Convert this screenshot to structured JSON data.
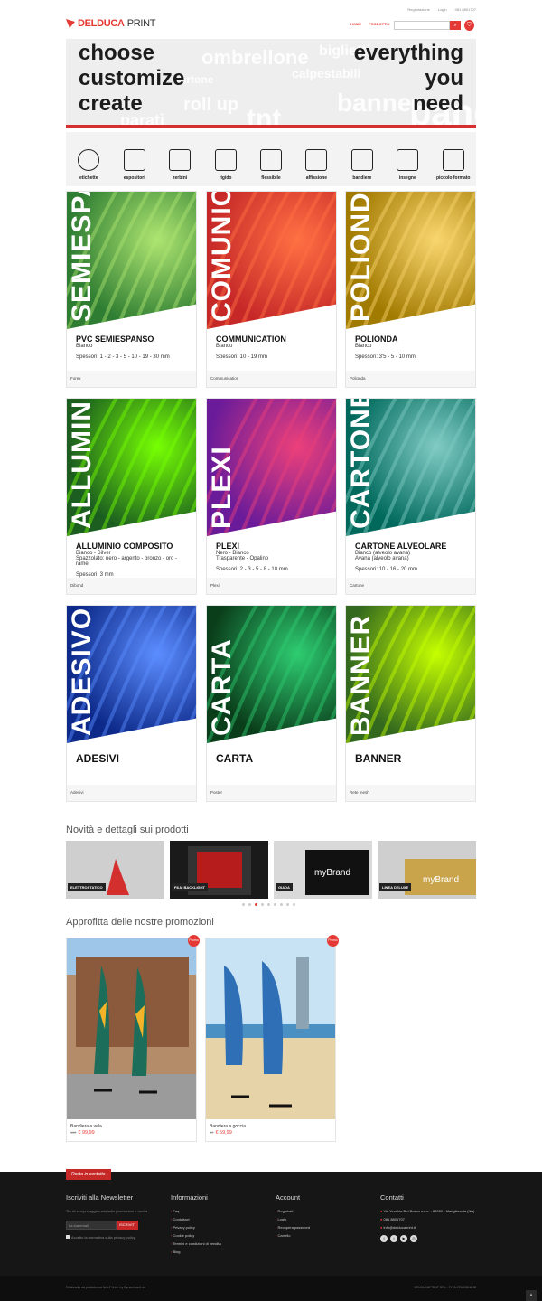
{
  "topbar": {
    "register": "Registrazione",
    "login": "Login",
    "phone": "081 8801707"
  },
  "logo": {
    "part1": "DELDUCA",
    "part2": "PRINT"
  },
  "nav": {
    "home": "HOME",
    "products": "PRODOTTI ▾"
  },
  "search": {
    "placeholder": ""
  },
  "hero": {
    "left": [
      "choose",
      "customize",
      "create"
    ],
    "right": [
      "everything",
      "you",
      "need"
    ],
    "bg_words": [
      "ombrellone",
      "biglietti",
      "cartone",
      "calpestabili",
      "banner",
      "roll up",
      "tnt",
      "bandiere",
      "parati"
    ]
  },
  "categories": [
    "etichette",
    "espositori",
    "zerbini",
    "rigido",
    "flessibile",
    "affissione",
    "bandiere",
    "insegne",
    "piccolo formato"
  ],
  "cards": [
    {
      "vword": "SEMIESPANSO",
      "title": "PVC SEMIESPANSO",
      "sub": [
        "Bianco"
      ],
      "sp": "Spessori: 1 - 2 - 3 - 5 - 10 - 19 - 30 mm",
      "foot": "Forex",
      "c1": "#2e7d32",
      "c2": "#aee571"
    },
    {
      "vword": "COMUNICATION",
      "title": "COMMUNICATION",
      "sub": [
        "Bianco"
      ],
      "sp": "Spessori: 10 - 19 mm",
      "foot": "Communication",
      "c1": "#c62828",
      "c2": "#ff7043"
    },
    {
      "vword": "POLIONDA",
      "title": "POLIONDA",
      "sub": [
        "Bianco"
      ],
      "sp": "Spessori: 3'5 - 5 - 10 mm",
      "foot": "Polionda",
      "c1": "#a17a00",
      "c2": "#f9d56e"
    },
    {
      "vword": "ALLUMINIO",
      "title": "ALLUMINIO COMPOSITO",
      "sub": [
        "Bianco - Silver",
        "Spazzolato: nero - argento - bronzo - oro - rame"
      ],
      "sp": "Spessori: 3 mm",
      "foot": "Dibond",
      "c1": "#1b5e20",
      "c2": "#76ff03"
    },
    {
      "vword": "PLEXI",
      "title": "PLEXI",
      "sub": [
        "Nero - Bianco",
        "Trasparente - Opalino"
      ],
      "sp": "Spessori: 2 - 3 - 5 - 8 - 10 mm",
      "foot": "Plexi",
      "c1": "#6a1b9a",
      "c2": "#ec407a"
    },
    {
      "vword": "CARTONE",
      "title": "CARTONE ALVEOLARE",
      "sub": [
        "Bianco (alveolo avana)",
        "Avana  (alveolo avana)"
      ],
      "sp": "Spessori: 10 - 16 - 20 mm",
      "foot": "Cartone",
      "c1": "#00695c",
      "c2": "#80cbc4"
    },
    {
      "vword": "ADESIVO",
      "title": "ADESIVI",
      "sub": [],
      "sp": "",
      "foot": "Adesivi",
      "c1": "#0d2a8a",
      "c2": "#5c8dff"
    },
    {
      "vword": "CARTA",
      "title": "CARTA",
      "sub": [],
      "sp": "",
      "foot": "Poster",
      "c1": "#0a3d1a",
      "c2": "#2ecc71"
    },
    {
      "vword": "BANNER",
      "title": "BANNER",
      "sub": [],
      "sp": "",
      "foot": "Rete mesh",
      "c1": "#33691e",
      "c2": "#c6ff00"
    }
  ],
  "novita": {
    "title": "Novità e dettagli sui prodotti",
    "slides": [
      "ELETTROSTATICO",
      "FILM BACKLIGHT",
      "GIADA",
      "LINEA DELUXE"
    ]
  },
  "promo": {
    "title": "Approfitta delle nostre promozioni",
    "items": [
      {
        "name": "Bandiera a vela",
        "old": "115",
        "price": "€ 99,99",
        "badge": "Promo"
      },
      {
        "name": "Bandiera a goccia",
        "old": "69",
        "price": "€ 59,99",
        "badge": "Promo"
      }
    ]
  },
  "footer": {
    "tag": "Rosta in contatto",
    "newsletter": {
      "title": "Iscriviti alla Newsletter",
      "text": "Tieniti sempre aggiornato sulle promozioni e novità",
      "placeholder": "La tua email",
      "button": "ISCRIVITI",
      "privacy": "Accetto la normativa sulla privacy policy"
    },
    "info": {
      "title": "Informazioni",
      "items": [
        "Faq",
        "Contattaci",
        "Privacy policy",
        "Cookie policy",
        "Termini e condizioni di vendita",
        "Blog"
      ]
    },
    "account": {
      "title": "Account",
      "items": [
        "Registrati",
        "Login",
        "Recupera password",
        "Carrello"
      ]
    },
    "contacts": {
      "title": "Contatti",
      "address": "Via Vecchia Del Bosco s.n.c. - 80050 - Mariglianella (NA)",
      "phone": "081 8801707",
      "email": "info@delducaprint.it"
    },
    "bottom_left": "Realizzato da piattaforma Neo-Printer by Dynamicsoft srl",
    "bottom_right": "DELDUCAPRINT SRL - P.IVA 07560561218"
  }
}
